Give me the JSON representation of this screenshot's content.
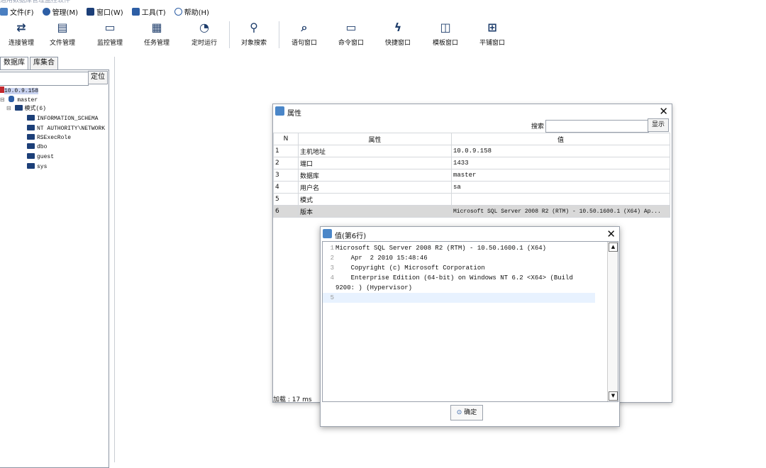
{
  "window": {
    "title": "通用数据库管理监控软件"
  },
  "menu": [
    {
      "label": "文件(F)",
      "icon": "file-icon"
    },
    {
      "label": "管理(M)",
      "icon": "gear-icon"
    },
    {
      "label": "窗口(W)",
      "icon": "window-icon"
    },
    {
      "label": "工具(T)",
      "icon": "tools-icon"
    },
    {
      "label": "帮助(H)",
      "icon": "help-icon"
    }
  ],
  "toolbar": [
    {
      "label": "连接管理",
      "icon": "⇄"
    },
    {
      "label": "文件管理",
      "icon": "▤"
    },
    {
      "label": "监控管理",
      "icon": "▭"
    },
    {
      "label": "任务管理",
      "icon": "▦"
    },
    {
      "label": "定时运行",
      "icon": "◔"
    },
    {
      "label": "对象搜索",
      "icon": "⚲"
    },
    {
      "label": "语句窗口",
      "icon": "⌕"
    },
    {
      "label": "命令窗口",
      "icon": "▭"
    },
    {
      "label": "快捷窗口",
      "icon": "ϟ"
    },
    {
      "label": "模板窗口",
      "icon": "◫"
    },
    {
      "label": "平铺窗口",
      "icon": "⊞"
    }
  ],
  "left": {
    "tabs": [
      "数据库",
      "库集合"
    ],
    "locate_label": "定位",
    "tree": {
      "server": "10.0.9.158",
      "database": "master",
      "schema_group": "模式(6)",
      "schemas": [
        "INFORMATION_SCHEMA",
        "NT AUTHORITY\\NETWORK",
        "RSExecRole",
        "dbo",
        "guest",
        "sys"
      ]
    }
  },
  "props_dialog": {
    "title": "属性",
    "search_label": "搜索",
    "show_label": "显示",
    "columns": [
      "N",
      "属性",
      "值"
    ],
    "rows": [
      {
        "n": "1",
        "key": "主机地址",
        "value": "10.0.9.158"
      },
      {
        "n": "2",
        "key": "端口",
        "value": "1433"
      },
      {
        "n": "3",
        "key": "数据库",
        "value": "master"
      },
      {
        "n": "4",
        "key": "用户名",
        "value": "sa"
      },
      {
        "n": "5",
        "key": "模式",
        "value": ""
      },
      {
        "n": "6",
        "key": "版本",
        "value": "Microsoft SQL Server 2008 R2 (RTM) - 10.50.1600.1 (X64) Ap..."
      }
    ],
    "status": "加载 : 17 ms"
  },
  "value_dialog": {
    "title": "值(第6行)",
    "lines": [
      {
        "n": "1",
        "text": "Microsoft SQL Server 2008 R2 (RTM) - 10.50.1600.1 (X64)"
      },
      {
        "n": "2",
        "text": "    Apr  2 2010 15:48:46"
      },
      {
        "n": "3",
        "text": "    Copyright (c) Microsoft Corporation"
      },
      {
        "n": "4",
        "text": "    Enterprise Edition (64-bit) on Windows NT 6.2 <X64> (Build"
      },
      {
        "n": "",
        "text": "9200: ) (Hypervisor)"
      },
      {
        "n": "5",
        "text": ""
      }
    ],
    "ok_label": "确定"
  }
}
